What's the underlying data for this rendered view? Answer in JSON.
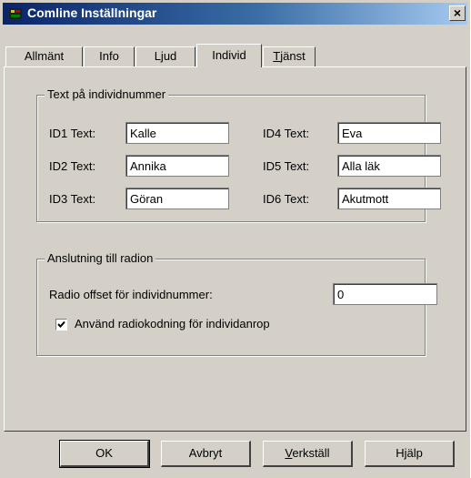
{
  "window": {
    "title": "Comline Inställningar",
    "close_label": "×"
  },
  "tabs": [
    "Allmänt",
    "Info",
    "Ljud",
    "Individ",
    "Tjänst"
  ],
  "active_tab": "Individ",
  "group_individ": {
    "legend": "Text på individnummer",
    "rows": [
      {
        "label": "ID1 Text:",
        "value": "Kalle"
      },
      {
        "label": "ID2 Text:",
        "value": "Annika"
      },
      {
        "label": "ID3 Text:",
        "value": "Göran"
      },
      {
        "label": "ID4 Text:",
        "value": "Eva"
      },
      {
        "label": "ID5 Text:",
        "value": "Alla läk"
      },
      {
        "label": "ID6 Text:",
        "value": "Akutmott"
      }
    ]
  },
  "group_radio": {
    "legend": "Anslutning till radion",
    "offset_label": "Radio offset för individnummer:",
    "offset_value": "0",
    "checkbox_label": "Använd radiokodning för individanrop",
    "checkbox_checked": true
  },
  "buttons": {
    "ok": "OK",
    "cancel": "Avbryt",
    "apply": "Verkställ",
    "help": "Hjälp"
  }
}
